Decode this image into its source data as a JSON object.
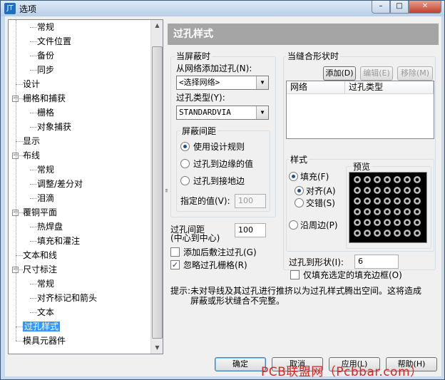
{
  "window": {
    "title": "选项",
    "icon_label": "JT"
  },
  "titlebar_buttons": {
    "minimize": "–",
    "maximize": "□",
    "close": "✕"
  },
  "tree": {
    "items": [
      {
        "label": "常规",
        "level": 2
      },
      {
        "label": "文件位置",
        "level": 2
      },
      {
        "label": "备份",
        "level": 2
      },
      {
        "label": "同步",
        "level": 2
      },
      {
        "label": "设计",
        "level": 1
      },
      {
        "label": "栅格和捕获",
        "level": 1,
        "expander": "−"
      },
      {
        "label": "栅格",
        "level": 2
      },
      {
        "label": "对象捕获",
        "level": 2
      },
      {
        "label": "显示",
        "level": 1
      },
      {
        "label": "布线",
        "level": 1,
        "expander": "−"
      },
      {
        "label": "常规",
        "level": 2
      },
      {
        "label": "调整/差分对",
        "level": 2
      },
      {
        "label": "泪滴",
        "level": 2
      },
      {
        "label": "覆铜平面",
        "level": 1,
        "expander": "−"
      },
      {
        "label": "热焊盘",
        "level": 2
      },
      {
        "label": "填充和灌注",
        "level": 2
      },
      {
        "label": "文本和线",
        "level": 1
      },
      {
        "label": "尺寸标注",
        "level": 1,
        "expander": "−"
      },
      {
        "label": "常规",
        "level": 2
      },
      {
        "label": "对齐标记和箭头",
        "level": 2
      },
      {
        "label": "文本",
        "level": 2
      },
      {
        "label": "过孔样式",
        "level": 1,
        "selected": true
      },
      {
        "label": "模具元器件",
        "level": 1
      }
    ],
    "scroll_up": "▲",
    "scroll_down": "▼"
  },
  "splitter_grip": "≡",
  "panel": {
    "banner": "过孔样式",
    "shield": {
      "title": "当屏蔽时",
      "add_via_from_net_label": "从网络添加过孔(N):",
      "net_combo_value": "<选择网络>",
      "via_type_label": "过孔类型(Y):",
      "via_type_value": "STANDARDVIA",
      "spacing_group": {
        "title": "屏蔽间距",
        "options": [
          "使用设计规则",
          "过孔到边缘的值",
          "过孔到接地边"
        ],
        "selected_index": 0,
        "specified_label": "指定的值(V):",
        "specified_value": "100"
      }
    },
    "stitch": {
      "title": "当缝合形状时",
      "add_button": "添加(D)",
      "edit_button": "编辑(E)",
      "remove_button": "移除(M)",
      "columns": [
        "网络",
        "过孔类型"
      ],
      "style": {
        "title": "样式",
        "fill_label": "填充(F)",
        "align_label": "对齐(A)",
        "stagger_label": "交错(S)",
        "along_edge_label": "沿周边(P)",
        "preview_label": "预览"
      },
      "via_to_shape_label": "过孔到形状(I):",
      "via_to_shape_value": "6",
      "only_fill_edge_label": "仅填充选定的填充边框(O)"
    },
    "via_spacing_label_line1": "过孔间距",
    "via_spacing_label_line2": "(中心到中心)",
    "via_spacing_value": "100",
    "add_after_flood_label": "添加后敷注过孔(G)",
    "add_after_flood_checked": false,
    "ignore_grid_label": "忽略过孔栅格(R)",
    "ignore_grid_checked": true,
    "checkmark": "✓",
    "hint_line1": "提示:未对导线及其过孔进行推挤以为过孔样式腾出空间。这将造成",
    "hint_line2": "屏蔽或形状缝合不完整。"
  },
  "buttons": {
    "ok": "确定",
    "cancel": "取消",
    "apply": "应用(L)",
    "help": "帮助(H)"
  },
  "watermark": "PCB联盟网（Pcbbar.com）"
}
